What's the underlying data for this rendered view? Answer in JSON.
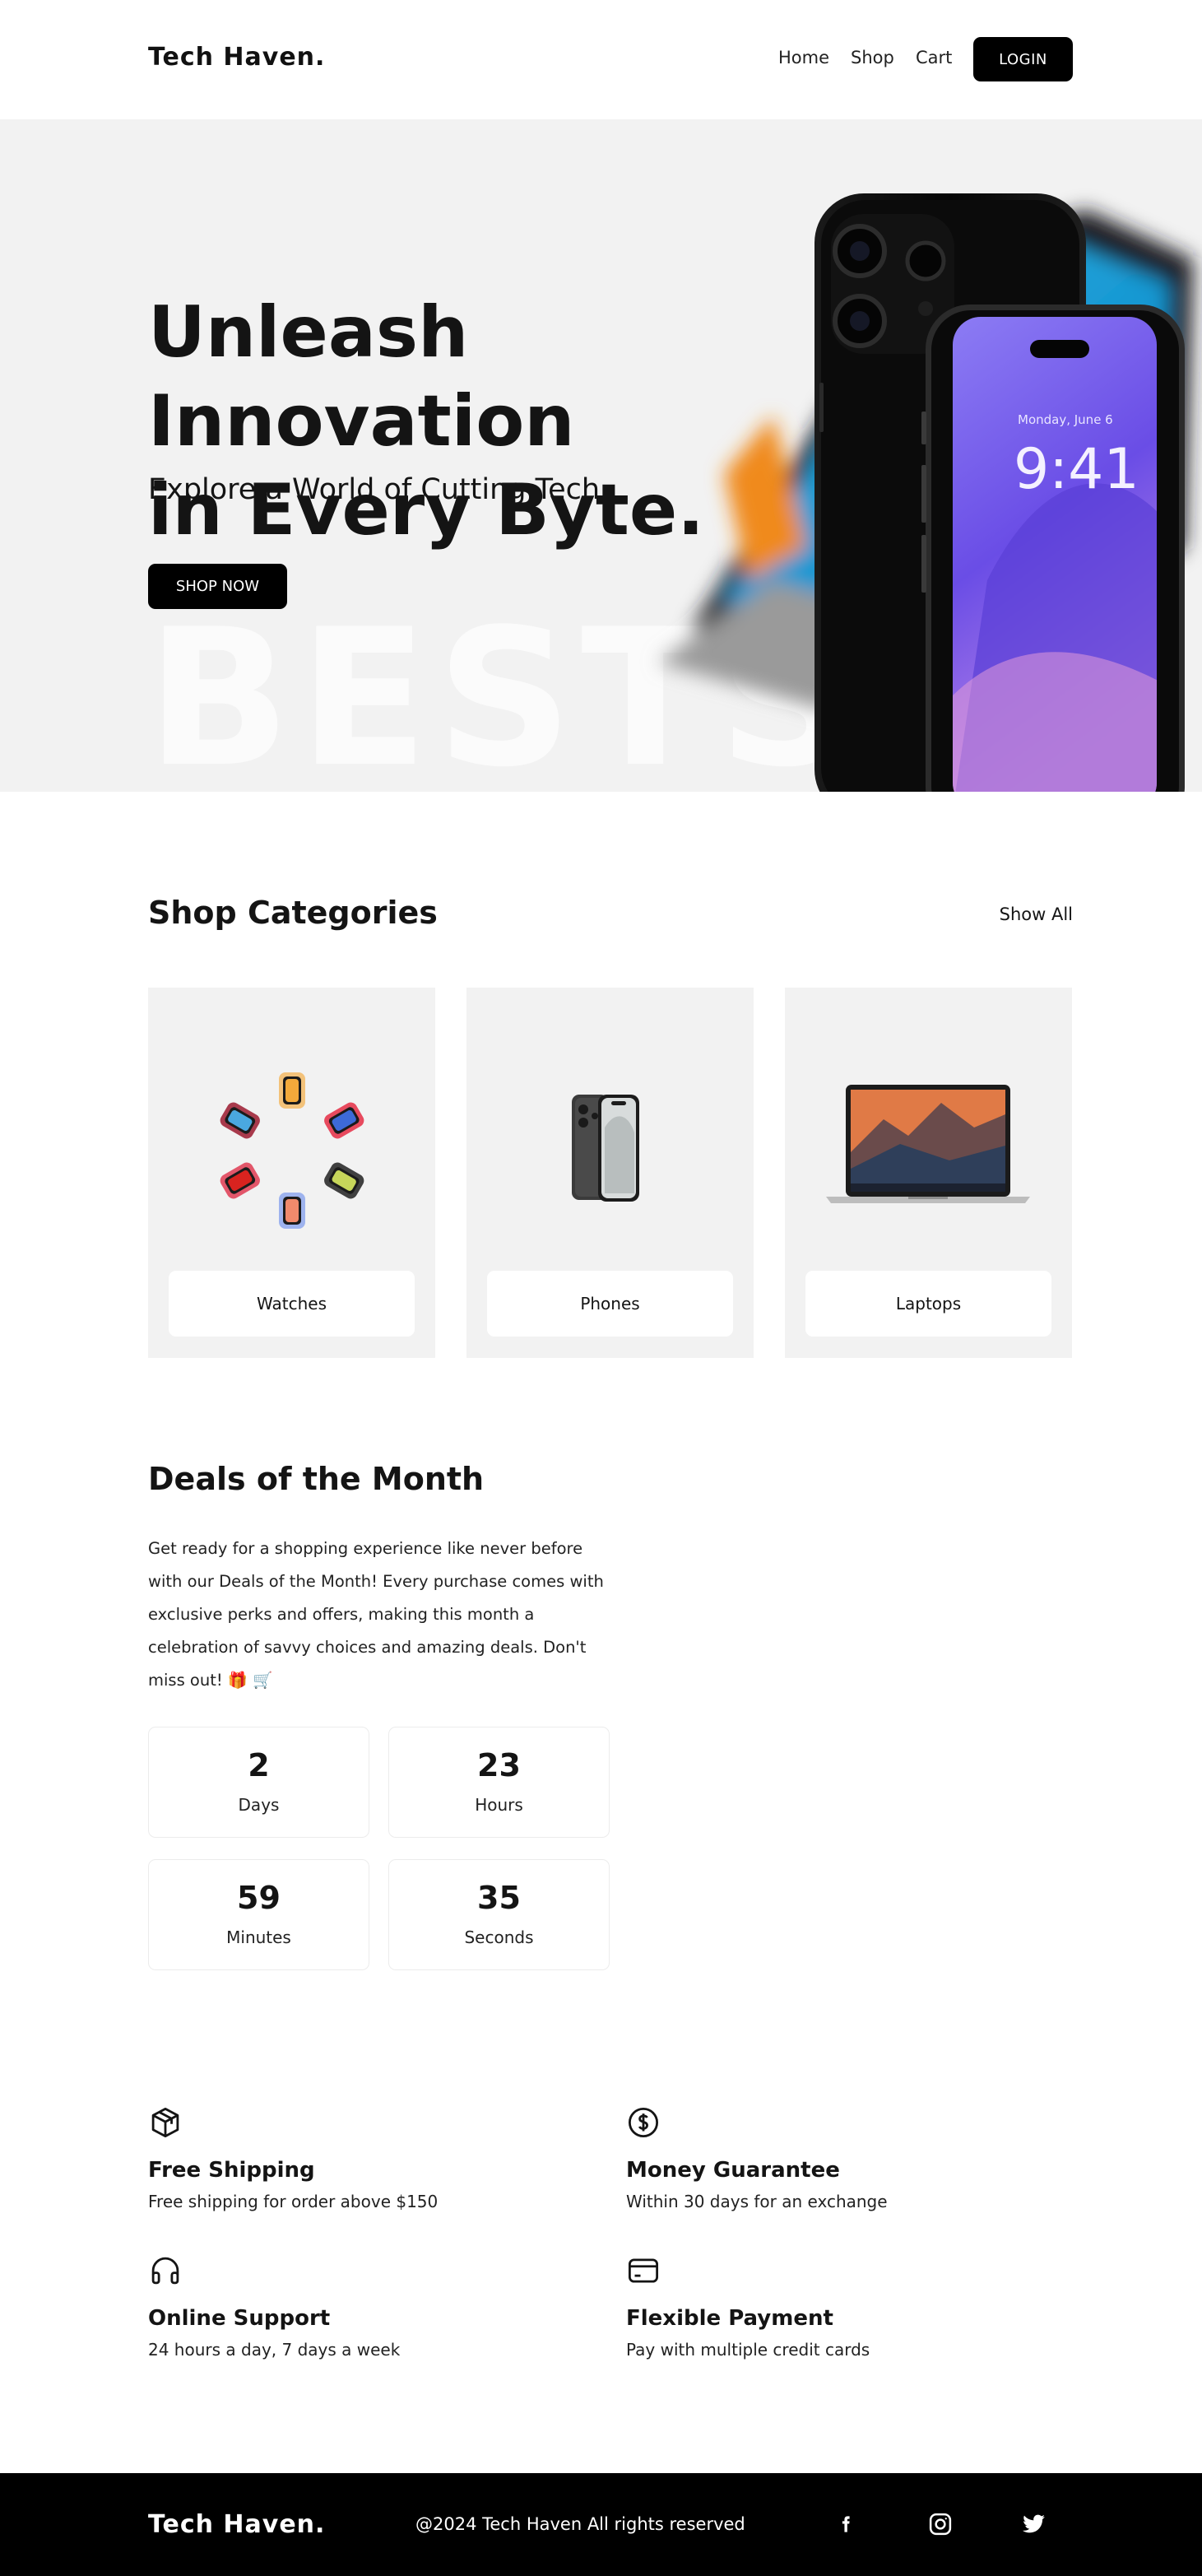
{
  "header": {
    "logo": "Tech Haven.",
    "nav": {
      "home": "Home",
      "shop": "Shop",
      "cart": "Cart"
    },
    "login": "LOGIN"
  },
  "hero": {
    "title_line1": "Unleash Innovation",
    "title_line2": "in Every Byte.",
    "subtitle": "Explore a World of Cutting Tech",
    "cta": "SHOP NOW",
    "bg_word": "BESTS",
    "phone_date": "Monday, June 6",
    "phone_time": "9:41"
  },
  "categories": {
    "title": "Shop Categories",
    "show_all": "Show All",
    "items": [
      {
        "label": "Watches",
        "icon": "watches-image"
      },
      {
        "label": "Phones",
        "icon": "phones-image"
      },
      {
        "label": "Laptops",
        "icon": "laptops-image"
      }
    ]
  },
  "deals": {
    "title": "Deals of the Month",
    "text": "Get ready for a shopping experience like never before with our Deals of the Month! Every purchase comes with exclusive perks and offers, making this month a celebration of savvy choices and amazing deals. Don't miss out! 🎁 🛒",
    "countdown": [
      {
        "value": "2",
        "unit": "Days"
      },
      {
        "value": "23",
        "unit": "Hours"
      },
      {
        "value": "59",
        "unit": "Minutes"
      },
      {
        "value": "35",
        "unit": "Seconds"
      }
    ]
  },
  "features": [
    {
      "title": "Free Shipping",
      "desc": "Free shipping for order above $150",
      "icon": "package-icon"
    },
    {
      "title": "Money Guarantee",
      "desc": "Within 30 days for an exchange",
      "icon": "dollar-coin-icon"
    },
    {
      "title": "Online Support",
      "desc": "24 hours a day, 7 days a week",
      "icon": "headphones-icon"
    },
    {
      "title": "Flexible Payment",
      "desc": "Pay with multiple credit cards",
      "icon": "credit-card-icon"
    }
  ],
  "footer": {
    "logo": "Tech Haven.",
    "copyright": "@2024 Tech Haven All rights reserved",
    "social": [
      "facebook-icon",
      "instagram-icon",
      "twitter-icon"
    ]
  },
  "colors": {
    "primary": "#000000",
    "hero_bg": "#f2f2f2",
    "card_bg": "#f2f2f2",
    "text": "#141414",
    "phone_screen": "#7b5cf0"
  }
}
